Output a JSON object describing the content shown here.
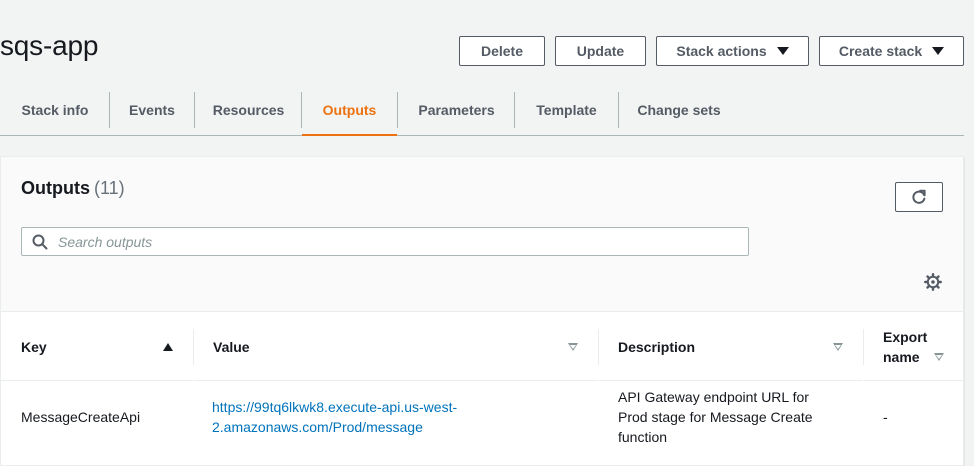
{
  "page": {
    "title": "sqs-app"
  },
  "header_actions": {
    "delete_label": "Delete",
    "update_label": "Update",
    "stack_actions_label": "Stack actions",
    "create_stack_label": "Create stack"
  },
  "tabs": [
    {
      "label": "Stack info",
      "active": false
    },
    {
      "label": "Events",
      "active": false
    },
    {
      "label": "Resources",
      "active": false
    },
    {
      "label": "Outputs",
      "active": true
    },
    {
      "label": "Parameters",
      "active": false
    },
    {
      "label": "Template",
      "active": false
    },
    {
      "label": "Change sets",
      "active": false
    }
  ],
  "outputs": {
    "title": "Outputs",
    "count": "(11)",
    "search_placeholder": "Search outputs",
    "columns": {
      "key": "Key",
      "value": "Value",
      "description": "Description",
      "export_name_line1": "Export",
      "export_name_line2": "name"
    },
    "rows": [
      {
        "key": "MessageCreateApi",
        "value_line1": "https://99tq6lkwk8.execute-api.us-west-",
        "value_line2": "2.amazonaws.com/Prod/message",
        "description_line1": "API Gateway endpoint URL for",
        "description_line2": "Prod stage for Message Create",
        "description_line3": "function",
        "export_name": "-"
      }
    ]
  },
  "icons": [
    "refresh-icon",
    "search-icon",
    "gear-icon",
    "caret-down-icon",
    "sort-ascending-icon",
    "sort-unsorted-icon"
  ],
  "colors": {
    "accent": "#ec7211",
    "link": "#0073bb",
    "background": "#f2f3f3",
    "button_border": "#545b64"
  }
}
